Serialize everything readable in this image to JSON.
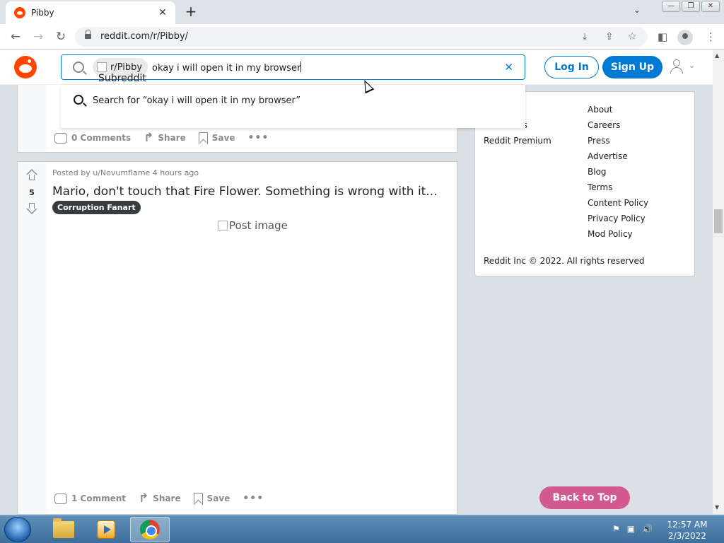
{
  "browser": {
    "tab_title": "Pibby",
    "tab_close": "✕",
    "new_tab": "+",
    "url": "reddit.com/r/Pibby/",
    "window_buttons": [
      "—",
      "❐",
      "✕"
    ]
  },
  "header": {
    "search_community": "r/Pibby",
    "search_community_type": "Subreddit",
    "search_query": "okay i will open it in my browser",
    "login_label": "Log In",
    "signup_label": "Sign Up"
  },
  "dropdown": {
    "search_for": "Search for “okay i will open it in my browser”"
  },
  "post1": {
    "comments": "0 Comments",
    "share": "Share",
    "save": "Save"
  },
  "post2": {
    "votes": "5",
    "meta": "Posted by u/Novumflame 4 hours ago",
    "title": "Mario, don't touch that Fire Flower. Something is wrong with it...",
    "flair": "Corruption Fanart",
    "image_alt": "Post image",
    "comments": "1 Comment",
    "share": "Share",
    "save": "Save"
  },
  "sidebar": {
    "col1": [
      "",
      "Reddit Coins",
      "Reddit Premium"
    ],
    "col1_visible": [
      "ns",
      "Reddit Premium"
    ],
    "col2": [
      "About",
      "Careers",
      "Press",
      "Advertise",
      "Blog",
      "Terms",
      "Content Policy",
      "Privacy Policy",
      "Mod Policy"
    ],
    "copyright": "Reddit Inc © 2022. All rights reserved",
    "back_to_top": "Back to Top"
  },
  "taskbar": {
    "time": "12:57 AM",
    "date": "2/3/2022"
  },
  "colors": {
    "reddit_orange": "#ff4500",
    "reddit_blue": "#0079d3",
    "back_to_top": "#d35991"
  }
}
